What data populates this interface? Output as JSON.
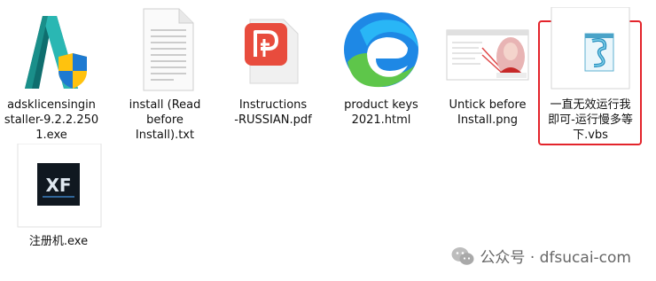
{
  "files": [
    {
      "name": "adsklicensinginstaller-9.2.2.2501.exe",
      "label": "adsklicensingin\nstaller-9.2.2.250\n1.exe",
      "icon": "autodesk-installer-icon"
    },
    {
      "name": "install (Read before Install).txt",
      "label": "install (Read\nbefore\nInstall).txt",
      "icon": "text-file-icon"
    },
    {
      "name": "Instructions-RUSSIAN.pdf",
      "label": "Instructions\n-RUSSIAN.pdf",
      "icon": "pdf-icon"
    },
    {
      "name": "product keys 2021.html",
      "label": "product keys\n2021.html",
      "icon": "edge-html-icon"
    },
    {
      "name": "Untick before Install.png",
      "label": "Untick before\nInstall.png",
      "icon": "png-thumbnail-icon"
    },
    {
      "name": "一直无效运行我即可-运行慢多等下.vbs",
      "label": "一直无效运行我\n即可-运行慢多等\n下.vbs",
      "icon": "vbs-script-icon"
    },
    {
      "name": "注册机.exe",
      "label": "注册机.exe",
      "icon": "xf-keygen-icon"
    }
  ],
  "watermark": {
    "text": "公众号 · dfsucai-com",
    "icon": "wechat-icon"
  },
  "colors": {
    "highlight": "#e3242b",
    "pdf": "#e84c3d",
    "edge_blue": "#1e88e5",
    "edge_green": "#5ec64a"
  }
}
